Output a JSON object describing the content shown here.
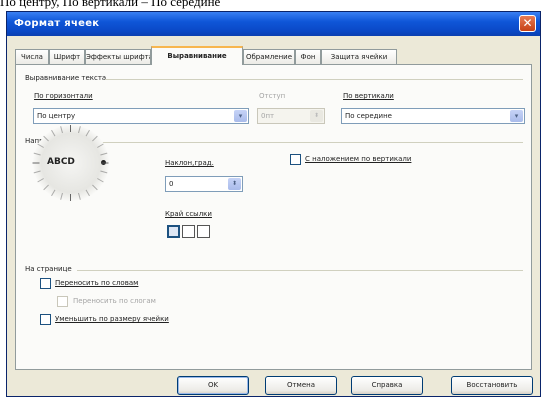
{
  "caption": "По центру, По вертикали – По середине",
  "window": {
    "title": "Формат ячеек",
    "close_glyph": "✕"
  },
  "tabs": [
    {
      "label": "Числа"
    },
    {
      "label": "Шрифт"
    },
    {
      "label": "Эффекты шрифта"
    },
    {
      "label": "Выравнивание",
      "active": true
    },
    {
      "label": "Обрамление"
    },
    {
      "label": "Фон"
    },
    {
      "label": "Защита ячейки"
    }
  ],
  "text_alignment": {
    "section_title": "Выравнивание текста",
    "horizontal_label": "По горизонтали",
    "horizontal_value": "По центру",
    "indent_label": "Отступ",
    "indent_value": "0пт",
    "vertical_label": "По вертикали",
    "vertical_value": "По середине"
  },
  "text_direction": {
    "section_title": "Направление текста",
    "dial_text": "ABCD",
    "angle_label": "Наклон,град.",
    "angle_value": "0",
    "stacked_label": "С наложением по вертикали",
    "reference_edge_label": "Край ссылки"
  },
  "page": {
    "section_title": "На странице",
    "wrap_words_label": "Переносить по словам",
    "hyphenation_label": "Переносить по слогам",
    "shrink_label": "Уменьшить по размеру ячейки"
  },
  "buttons": {
    "ok": "OK",
    "cancel": "Отмена",
    "help": "Справка",
    "reset": "Восстановить"
  },
  "icons": {
    "combo_arrow": "▾",
    "spin_arrows": "⬍"
  }
}
